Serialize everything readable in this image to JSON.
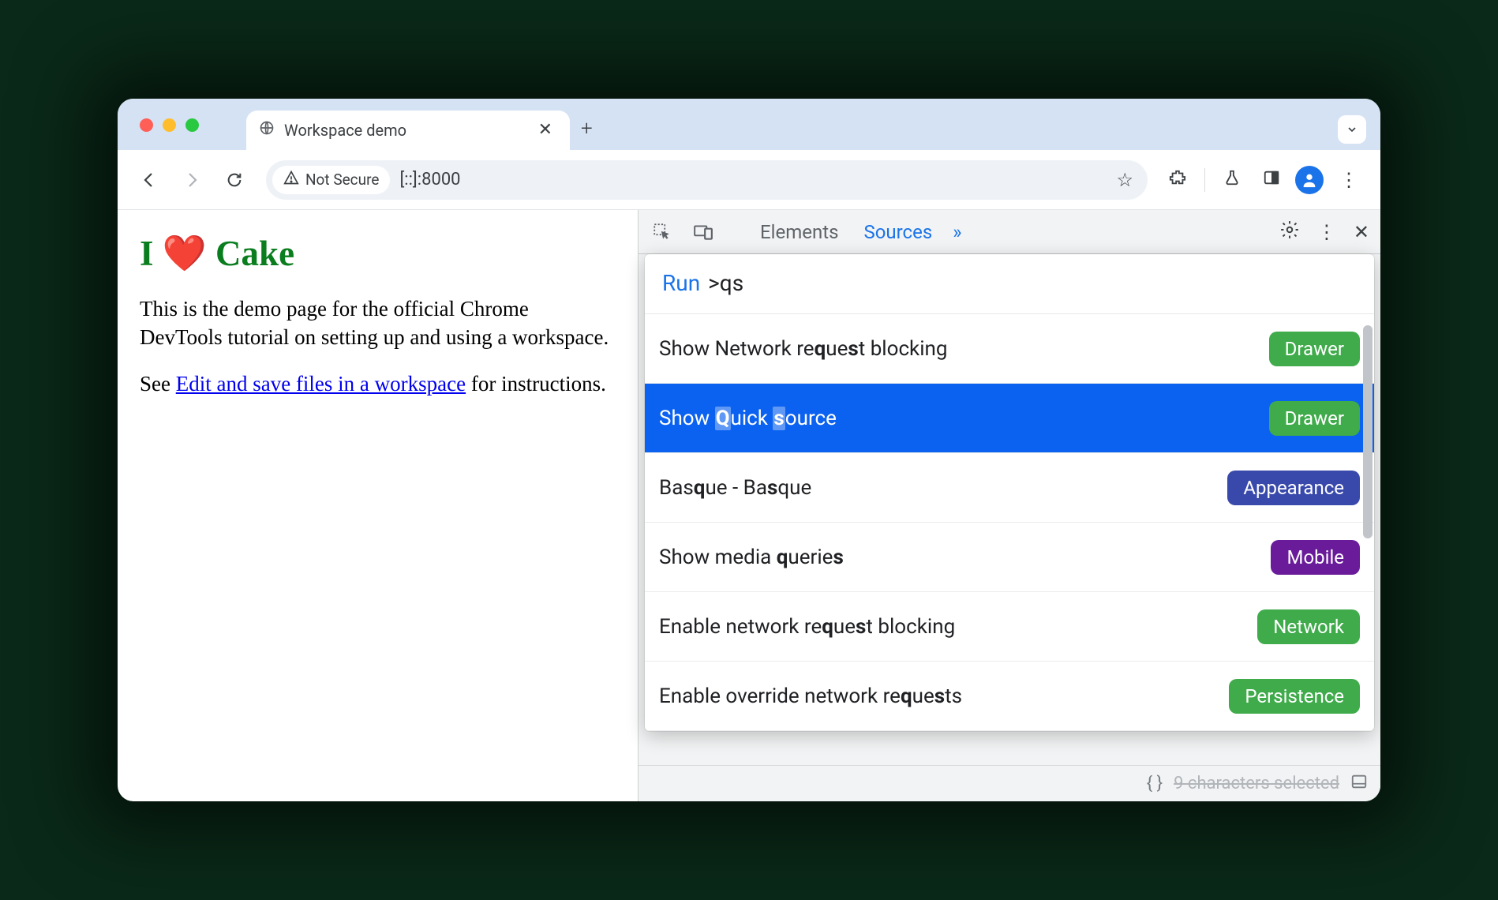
{
  "browser": {
    "tab_title": "Workspace demo",
    "security_label": "Not Secure",
    "url_display": "[::]:8000"
  },
  "page": {
    "heading": "I ❤️ Cake",
    "para1": "This is the demo page for the official Chrome DevTools tutorial on setting up and using a workspace.",
    "para2_pre": "See ",
    "link_text": "Edit and save files in a workspace",
    "para2_post": " for instructions."
  },
  "devtools": {
    "tabs": {
      "elements": "Elements",
      "sources": "Sources"
    },
    "command": {
      "run_label": "Run",
      "query": ">qs"
    },
    "results": [
      {
        "pre": "Show Network re",
        "b1": "q",
        "mid": "ue",
        "b2": "s",
        "post": "t blocking",
        "badge": "Drawer",
        "badge_color": "#3fab4b",
        "selected": false
      },
      {
        "pre": "Show ",
        "b1": "Q",
        "mid": "uick ",
        "b2": "s",
        "post": "ource",
        "badge": "Drawer",
        "badge_color": "#3fab4b",
        "selected": true
      },
      {
        "pre": "Bas",
        "b1": "q",
        "mid": "ue - Ba",
        "b2": "s",
        "post": "que",
        "badge": "Appearance",
        "badge_color": "#3949ab",
        "selected": false
      },
      {
        "pre": "Show media ",
        "b1": "q",
        "mid": "uerie",
        "b2": "s",
        "post": "",
        "badge": "Mobile",
        "badge_color": "#6a1b9a",
        "selected": false
      },
      {
        "pre": "Enable network re",
        "b1": "q",
        "mid": "ue",
        "b2": "s",
        "post": "t blocking",
        "badge": "Network",
        "badge_color": "#3fab4b",
        "selected": false
      },
      {
        "pre": "Enable override network re",
        "b1": "q",
        "mid": "ue",
        "b2": "s",
        "post": "ts",
        "badge": "Persistence",
        "badge_color": "#3fab4b",
        "selected": false
      }
    ],
    "status_text": "9 characters selected"
  }
}
